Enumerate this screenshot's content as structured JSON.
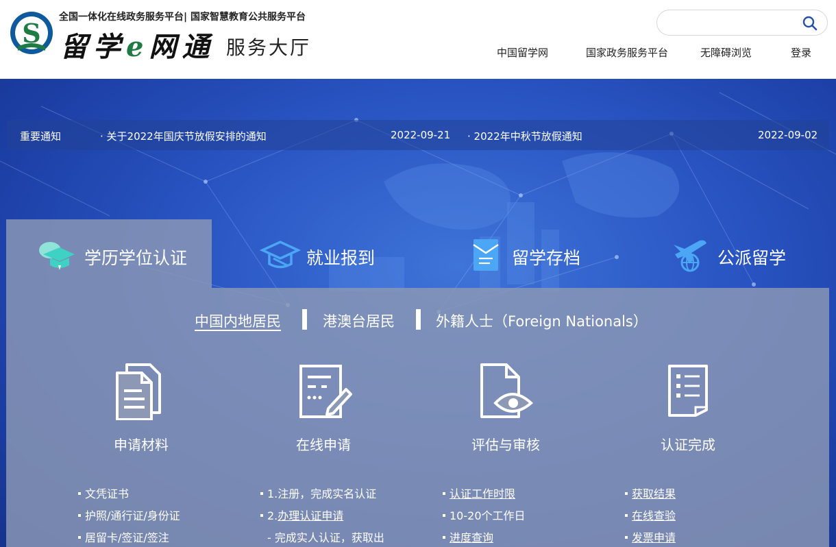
{
  "header": {
    "platform_line": "全国一体化在线政务服务平台| 国家智慧教育公共服务平台",
    "brand_before": "留学",
    "brand_e": "e",
    "brand_after": "网通",
    "brand_suffix": "服务大厅",
    "search": {
      "placeholder": "",
      "value": ""
    },
    "nav": [
      "中国留学网",
      "国家政务服务平台",
      "无障碍浏览",
      "登录"
    ]
  },
  "notices": {
    "label": "重要通知",
    "items": [
      {
        "title": "关于2022年国庆节放假安排的通知",
        "date": "2022-09-21"
      },
      {
        "title": "2022年中秋节放假通知",
        "date": "2022-09-02"
      }
    ]
  },
  "tabs": [
    {
      "label": "学历学位认证",
      "icon": "graduation-cap-icon"
    },
    {
      "label": "就业报到",
      "icon": "employment-cap-icon"
    },
    {
      "label": "留学存档",
      "icon": "archive-envelope-icon"
    },
    {
      "label": "公派留学",
      "icon": "airplane-globe-icon"
    }
  ],
  "subtabs": [
    "中国内地居民",
    "港澳台居民",
    "外籍人士（Foreign Nationals）"
  ],
  "steps": [
    {
      "title": "申请材料",
      "icon": "documents-icon",
      "links": [
        "文凭证书",
        "护照/通行证/身份证",
        "居留卡/签证/签注"
      ]
    },
    {
      "title": "在线申请",
      "icon": "form-edit-icon",
      "links": [
        "1.注册，完成实名认证",
        "2.办理认证申请",
        "- 完成实人认证，获取出"
      ]
    },
    {
      "title": "评估与审核",
      "icon": "document-eye-icon",
      "links": [
        "认证工作时限",
        "10-20个工作日",
        "进度查询"
      ]
    },
    {
      "title": "认证完成",
      "icon": "checklist-icon",
      "links": [
        "获取结果",
        "在线查验",
        "发票申请"
      ]
    }
  ],
  "colors": {
    "hero_blue": "#2a56c4",
    "panel_gray": "#8c98b4",
    "brand_green": "#1e7b43",
    "teal_accent": "#3fd1c4"
  }
}
